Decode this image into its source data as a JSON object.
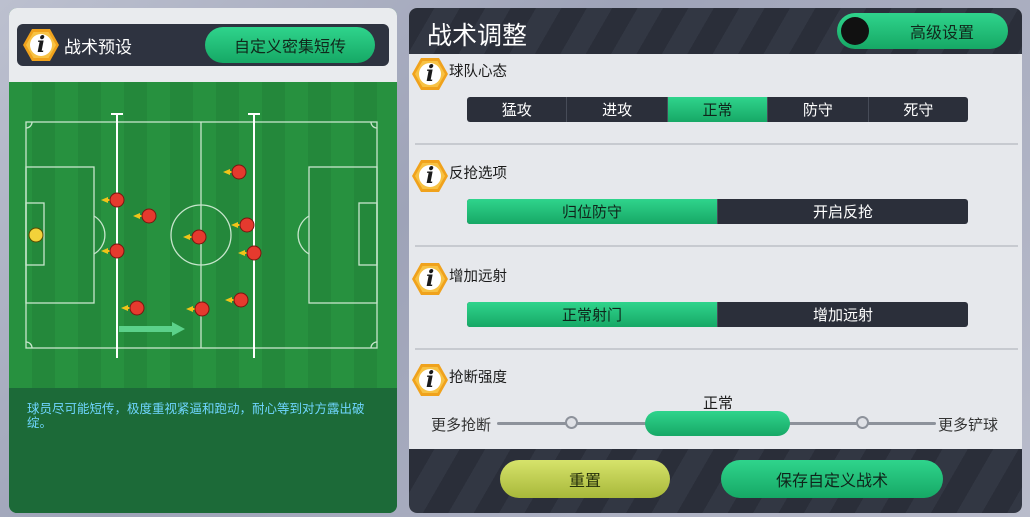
{
  "left_panel": {
    "title": "战术预设",
    "preset_button_label": "自定义密集短传",
    "info_icon_glyph": "i",
    "description": "球员尽可能短传，极度重视紧逼和跑动，耐心等到对方露出破绽。",
    "pitch": {
      "goalkeeper_color": "#f2d23a",
      "player_color": "#e53a2e",
      "arrow_color": "#f0c419"
    }
  },
  "right_panel": {
    "title": "战术调整",
    "advanced_settings_label": "高级设置",
    "sections": [
      {
        "title": "球队心态",
        "options": [
          "猛攻",
          "进攻",
          "正常",
          "防守",
          "死守"
        ],
        "selected": "正常"
      },
      {
        "title": "反抢选项",
        "options": [
          "归位防守",
          "开启反抢"
        ],
        "selected": "归位防守"
      },
      {
        "title": "增加远射",
        "options": [
          "正常射门",
          "增加远射"
        ],
        "selected": "正常射门"
      }
    ],
    "tackle_intensity": {
      "title": "抢断强度",
      "left_label": "更多抢断",
      "right_label": "更多铲球",
      "value": "正常"
    },
    "reset_label": "重置",
    "save_label": "保存自定义战术"
  },
  "colors": {
    "accent_green": "#1fbf78",
    "dark_bar": "#2b2f3a",
    "hex_orange": "#f0a21c"
  }
}
